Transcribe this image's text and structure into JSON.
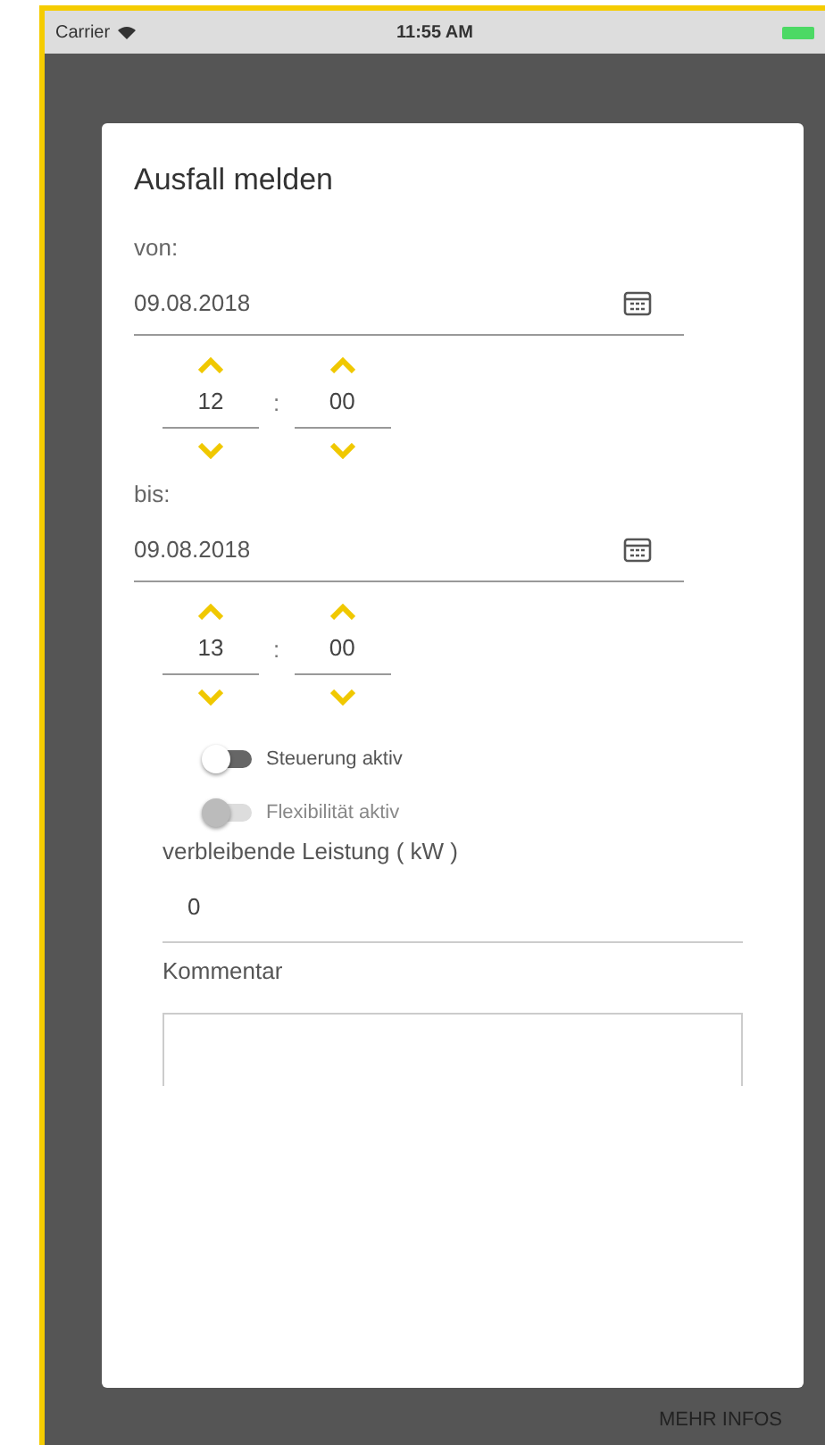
{
  "status_bar": {
    "carrier": "Carrier",
    "time": "11:55 AM"
  },
  "dialog": {
    "title": "Ausfall melden",
    "ranges": [
      {
        "label": "von:",
        "date": "09.08.2018",
        "hour": "12",
        "separator": ":",
        "minute": "00"
      },
      {
        "label": "bis:",
        "date": "09.08.2018",
        "hour": "13",
        "separator": ":",
        "minute": "00"
      }
    ],
    "toggles": [
      {
        "label": "Steuerung aktiv",
        "on": false,
        "disabled": false
      },
      {
        "label": "Flexibilität aktiv",
        "on": false,
        "disabled": true
      }
    ],
    "power": {
      "label": "verbleibende Leistung ( kW )",
      "value": "0"
    },
    "comment": {
      "label": "Kommentar"
    }
  },
  "footer_link": "MEHR INFOS"
}
